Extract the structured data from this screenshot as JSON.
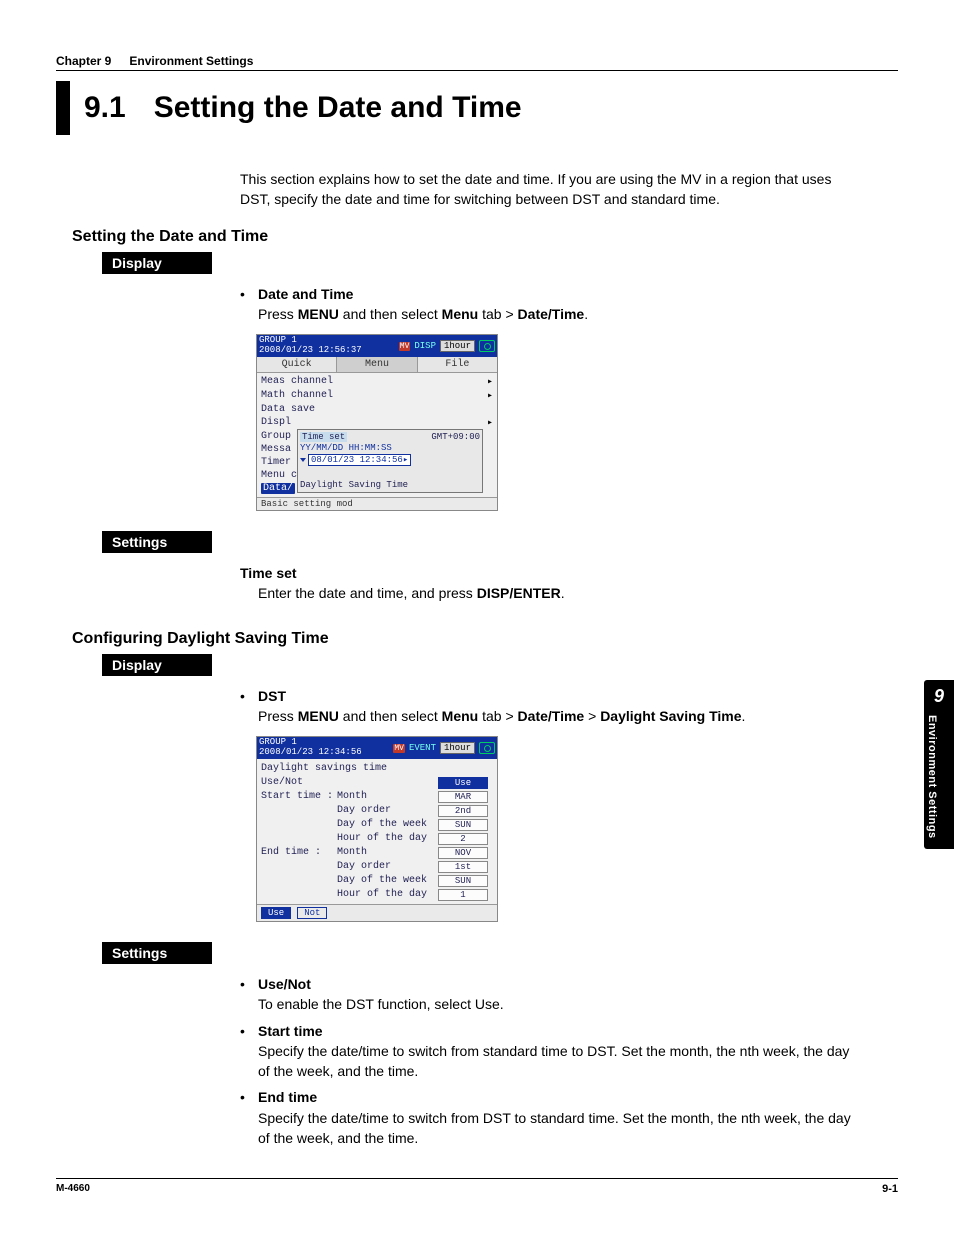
{
  "header": {
    "chapter_label": "Chapter 9",
    "chapter_title": "Environment Settings"
  },
  "title": {
    "number": "9.1",
    "text": "Setting the Date and Time"
  },
  "intro": "This section explains how to set the date and time. If you are using the MV in a region that uses DST, specify the date and time for switching between DST and standard time.",
  "section1": {
    "heading": "Setting the Date and Time",
    "display_tag": "Display",
    "bullet_title": "Date and Time",
    "bullet_line_pre": "Press ",
    "bullet_line_menu": "MENU",
    "bullet_line_mid": " and then select ",
    "bullet_line_bold2": "Menu",
    "bullet_line_mid2": " tab > ",
    "bullet_line_bold3": "Date/Time",
    "bullet_line_end": ".",
    "screenshot": {
      "group": "GROUP 1",
      "timestamp": "2008/01/23 12:56:37",
      "badge": "DISP",
      "hour_btn": "1hour",
      "tabs": [
        "Quick",
        "Menu",
        "File"
      ],
      "rows": [
        "Meas channel",
        "Math channel",
        "Data save",
        "Displ",
        "Group",
        "Messa",
        "Timer",
        "Menu c"
      ],
      "highlight_row": "Data/",
      "popup_title": "Time set",
      "popup_tz": "GMT+09:00",
      "popup_fmt": "YY/MM/DD  HH:MM:SS",
      "popup_value": "08/01/23 12:34:56",
      "popup_dst": "Daylight Saving Time",
      "bottom_left": "Basic setting mod",
      "bottom_right": " "
    },
    "settings_tag": "Settings",
    "settings_heading": "Time set",
    "settings_line_pre": "Enter the date and time, and press ",
    "settings_line_bold": "DISP/ENTER",
    "settings_line_end": "."
  },
  "section2": {
    "heading": "Configuring Daylight Saving Time",
    "display_tag": "Display",
    "bullet_title": "DST",
    "bullet_line_pre": "Press ",
    "bullet_line_menu": "MENU",
    "bullet_line_mid": " and then select ",
    "bullet_line_bold2": "Menu",
    "bullet_line_mid2": " tab > ",
    "bullet_line_bold3": "Date/Time",
    "bullet_line_mid3": " > ",
    "bullet_line_bold4": "Daylight Saving Time",
    "bullet_line_end": ".",
    "screenshot": {
      "group": "GROUP 1",
      "timestamp": "2008/01/23 12:34:56",
      "badge": "EVENT",
      "hour_btn": "1hour",
      "heading": "Daylight savings time",
      "use_label": "Use/Not",
      "use_value": "Use",
      "start_label": "Start time  :",
      "end_label": "End time    :",
      "fields": {
        "month": "Month",
        "day_order": "Day order",
        "day_of_week": "Day of the week",
        "hour_of_day": "Hour of the day"
      },
      "start_values": {
        "month": "MAR",
        "day_order": "2nd",
        "dow": "SUN",
        "hour": "2"
      },
      "end_values": {
        "month": "NOV",
        "day_order": "1st",
        "dow": "SUN",
        "hour": "1"
      },
      "foot_use": "Use",
      "foot_not": "Not"
    },
    "settings_tag": "Settings",
    "bullets": [
      {
        "title": "Use/Not",
        "body": "To enable the DST function, select Use."
      },
      {
        "title": "Start time",
        "body": "Specify the date/time to switch from standard time to DST. Set the month, the nth week, the day of the week, and the time."
      },
      {
        "title": "End time",
        "body": "Specify the date/time to switch from DST to standard time. Set the month, the nth week, the day of the week, and the time."
      }
    ]
  },
  "side_tab": {
    "num": "9",
    "text": "Environment Settings"
  },
  "footer": {
    "left": "M-4660",
    "right": "9-1"
  }
}
